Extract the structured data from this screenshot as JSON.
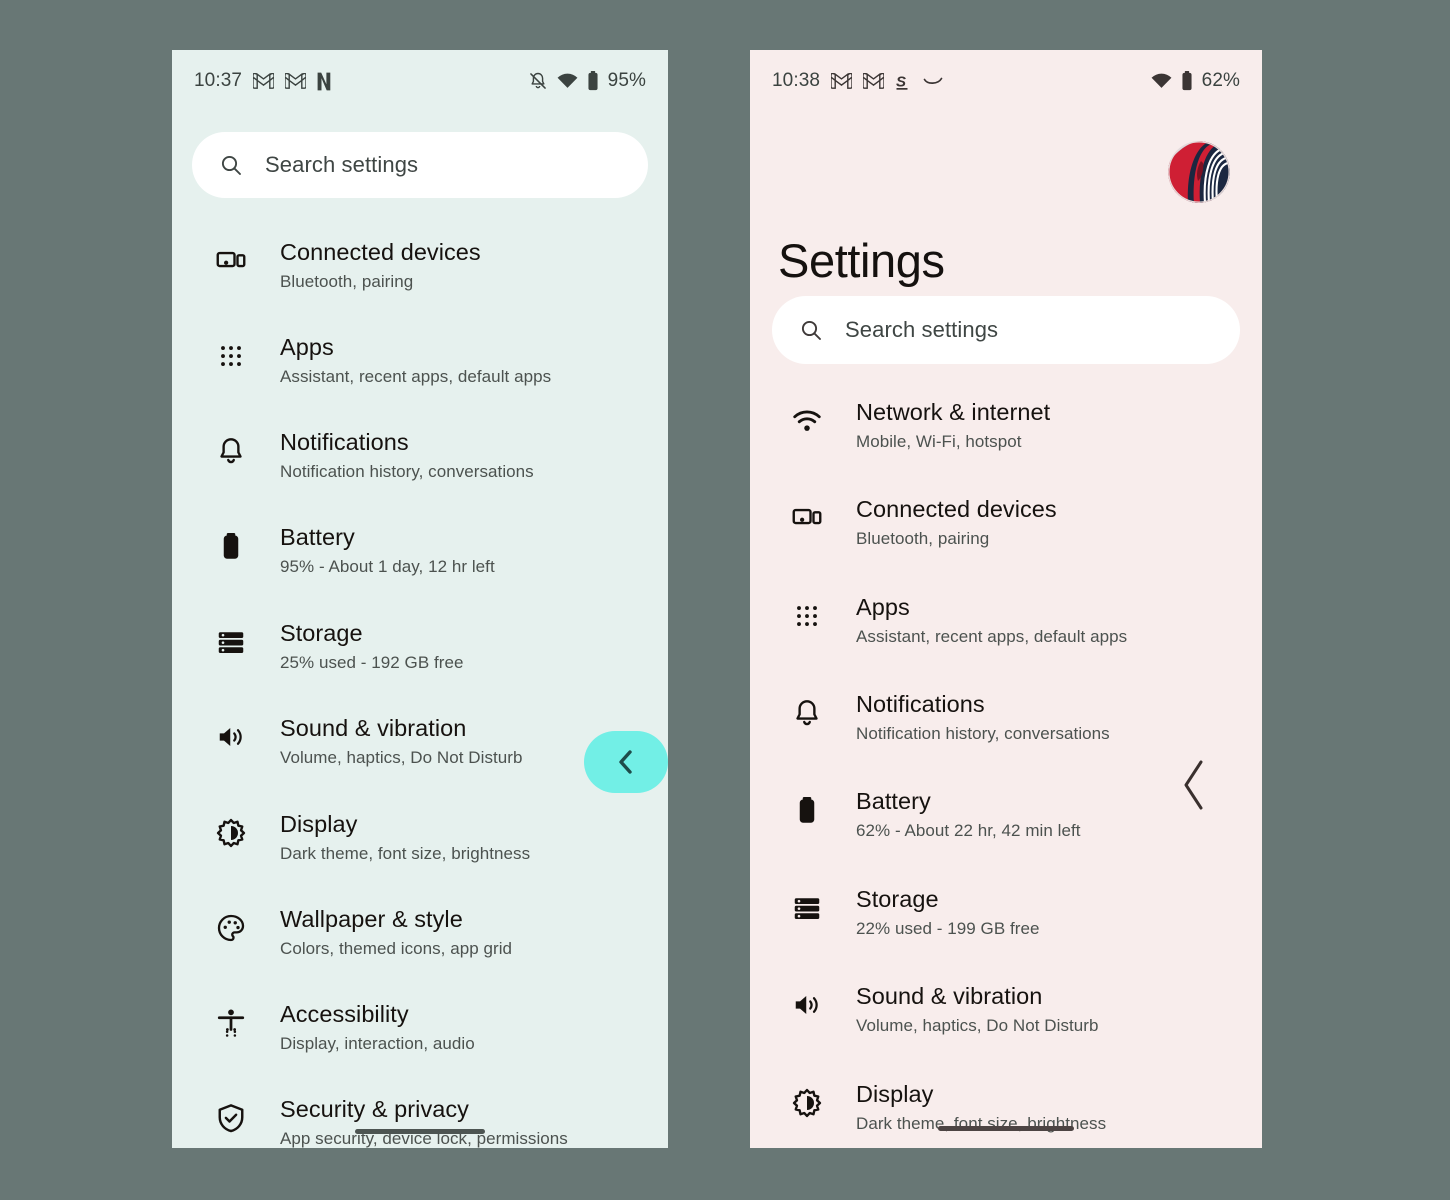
{
  "canvas": {
    "background": "#687775"
  },
  "phones": [
    {
      "id": "left",
      "background": "#e6f1ee",
      "status_bar": {
        "time": "10:37",
        "battery_percent": "95%",
        "left_icons": [
          "gmail-icon",
          "gmail-icon",
          "netflix-icon"
        ],
        "right_icons": [
          "notifications-off-icon",
          "wifi-icon",
          "battery-icon"
        ]
      },
      "search": {
        "placeholder": "Search settings",
        "icon": "search-icon"
      },
      "title": null,
      "avatar": null,
      "items": [
        {
          "icon": "connected-devices-icon",
          "title": "Connected devices",
          "subtitle": "Bluetooth, pairing"
        },
        {
          "icon": "apps-icon",
          "title": "Apps",
          "subtitle": "Assistant, recent apps, default apps"
        },
        {
          "icon": "notifications-icon",
          "title": "Notifications",
          "subtitle": "Notification history, conversations"
        },
        {
          "icon": "battery-icon",
          "title": "Battery",
          "subtitle": "95% - About 1 day, 12 hr left"
        },
        {
          "icon": "storage-icon",
          "title": "Storage",
          "subtitle": "25% used - 192 GB free"
        },
        {
          "icon": "sound-icon",
          "title": "Sound & vibration",
          "subtitle": "Volume, haptics, Do Not Disturb"
        },
        {
          "icon": "display-icon",
          "title": "Display",
          "subtitle": "Dark theme, font size, brightness"
        },
        {
          "icon": "wallpaper-icon",
          "title": "Wallpaper & style",
          "subtitle": "Colors, themed icons, app grid"
        },
        {
          "icon": "accessibility-icon",
          "title": "Accessibility",
          "subtitle": "Display, interaction, audio"
        },
        {
          "icon": "security-icon",
          "title": "Security & privacy",
          "subtitle": "App security, device lock, permissions"
        }
      ],
      "back_gesture": {
        "style": "pill",
        "pill_color": "#72efe6",
        "chevron_color": "#1e4c4a",
        "icon": "chevron-left-icon"
      },
      "home_indicator_color": "#4d5552"
    },
    {
      "id": "right",
      "background": "#f8edec",
      "status_bar": {
        "time": "10:38",
        "battery_percent": "62%",
        "left_icons": [
          "gmail-icon",
          "gmail-icon",
          "strava-icon",
          "curve-icon"
        ],
        "right_icons": [
          "wifi-icon",
          "battery-icon"
        ]
      },
      "search": {
        "placeholder": "Search settings",
        "icon": "search-icon"
      },
      "title": "Settings",
      "avatar": {
        "name": "account-avatar",
        "colors": [
          "#c9dce4",
          "#cf1f34",
          "#1b2740",
          "#ffffff"
        ]
      },
      "items": [
        {
          "icon": "network-icon",
          "title": "Network & internet",
          "subtitle": "Mobile, Wi-Fi, hotspot"
        },
        {
          "icon": "connected-devices-icon",
          "title": "Connected devices",
          "subtitle": "Bluetooth, pairing"
        },
        {
          "icon": "apps-icon",
          "title": "Apps",
          "subtitle": "Assistant, recent apps, default apps"
        },
        {
          "icon": "notifications-icon",
          "title": "Notifications",
          "subtitle": "Notification history, conversations"
        },
        {
          "icon": "battery-icon",
          "title": "Battery",
          "subtitle": "62% - About 22 hr, 42 min left"
        },
        {
          "icon": "storage-icon",
          "title": "Storage",
          "subtitle": "22% used - 199 GB free"
        },
        {
          "icon": "sound-icon",
          "title": "Sound & vibration",
          "subtitle": "Volume, haptics, Do Not Disturb"
        },
        {
          "icon": "display-icon",
          "title": "Display",
          "subtitle": "Dark theme, font size, brightness"
        }
      ],
      "back_gesture": {
        "style": "chevron",
        "chevron_color": "#3a302e",
        "icon": "chevron-left-icon"
      },
      "home_indicator_color": "#4d4443"
    }
  ]
}
